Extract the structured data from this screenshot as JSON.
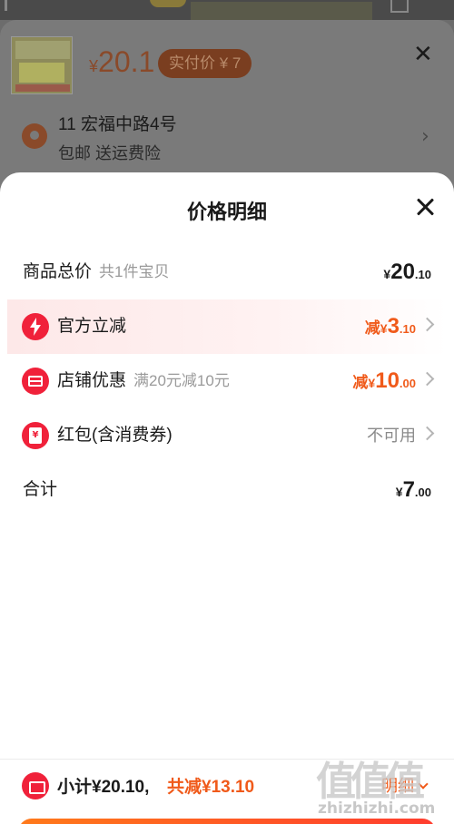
{
  "background": {
    "product_price": "20.1",
    "currency": "¥",
    "paid_label": "实付价 ¥ 7",
    "address": "11 宏福中路4号",
    "shipping": "包邮  送运费险"
  },
  "sheet": {
    "title": "价格明细",
    "rows": [
      {
        "label": "商品总价",
        "sub": "共1件宝贝",
        "currency": "¥",
        "int": "20",
        "dec": ".10"
      },
      {
        "label": "官方立减",
        "icon": "lightning-icon",
        "prefix": "减",
        "currency": "¥",
        "int": "3",
        "dec": ".10"
      },
      {
        "label": "店铺优惠",
        "sub": "满20元减10元",
        "icon": "store-icon",
        "prefix": "减",
        "currency": "¥",
        "int": "10",
        "dec": ".00"
      },
      {
        "label": "红包(含消费券)",
        "icon": "red-envelope-icon",
        "value": "不可用"
      },
      {
        "label": "合计",
        "currency": "¥",
        "int": "7",
        "dec": ".00"
      }
    ]
  },
  "bottom": {
    "subtotal": "小计¥20.10,",
    "total_discount": "共减¥13.10",
    "detail_label": "明细"
  },
  "watermark": {
    "text": "zhizhizhi.com"
  },
  "colors": {
    "accent_red": "#f0213a",
    "discount_orange": "#f05a1a"
  }
}
